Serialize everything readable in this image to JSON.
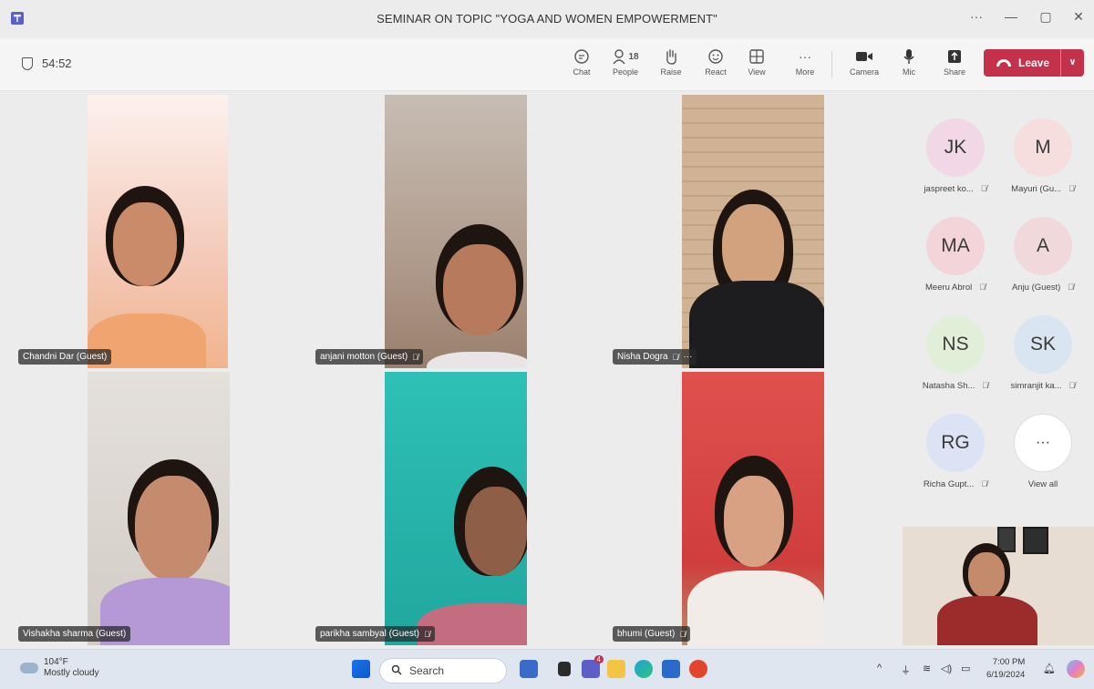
{
  "window": {
    "title": "SEMINAR ON TOPIC \"YOGA AND WOMEN EMPOWERMENT\"",
    "controls": [
      "···",
      "—",
      "▢",
      "✕"
    ]
  },
  "toolbar": {
    "timer": "54:52",
    "people_count": "18",
    "buttons": {
      "chat": "Chat",
      "people": "People",
      "raise": "Raise",
      "react": "React",
      "view": "View",
      "more": "More",
      "camera": "Camera",
      "mic": "Mic",
      "share": "Share"
    },
    "leave": "Leave",
    "leave_color": "#c4314b"
  },
  "participants": [
    {
      "name": "Chandni Dar (Guest)",
      "muted": false,
      "more": false,
      "bg": "#f3c9b8"
    },
    {
      "name": "anjani motton (Guest)",
      "muted": true,
      "more": false,
      "bg": "#b9a79a"
    },
    {
      "name": "Nisha Dogra",
      "muted": true,
      "more": true,
      "bg": "#c8a98b"
    },
    {
      "name": "Vishakha sharma (Guest)",
      "muted": false,
      "more": false,
      "bg": "#d9d4ce"
    },
    {
      "name": "parikha sambyal (Guest)",
      "muted": true,
      "more": false,
      "bg": "#2bb5ad"
    },
    {
      "name": "bhumi (Guest)",
      "muted": true,
      "more": false,
      "bg": "#d84a48"
    }
  ],
  "roster": [
    {
      "initials": "JK",
      "name": "jaspreet ko...",
      "color": "#f2d7e6"
    },
    {
      "initials": "M",
      "name": "Mayuri (Gu...",
      "color": "#f6dede"
    },
    {
      "initials": "MA",
      "name": "Meeru Abrol",
      "color": "#f3d4d8"
    },
    {
      "initials": "A",
      "name": "Anju (Guest)",
      "color": "#f1d8da"
    },
    {
      "initials": "NS",
      "name": "Natasha Sh...",
      "color": "#e2efd8"
    },
    {
      "initials": "SK",
      "name": "simranjit ka...",
      "color": "#d9e6f2"
    },
    {
      "initials": "RG",
      "name": "Richa Gupt...",
      "color": "#dbe3f4"
    }
  ],
  "view_all": {
    "label": "View all",
    "icon": "···"
  },
  "taskbar": {
    "weather_temp": "104°F",
    "weather_desc": "Mostly cloudy",
    "search": "Search",
    "time": "7:00 PM",
    "date": "6/19/2024",
    "teams_badge": "4"
  }
}
